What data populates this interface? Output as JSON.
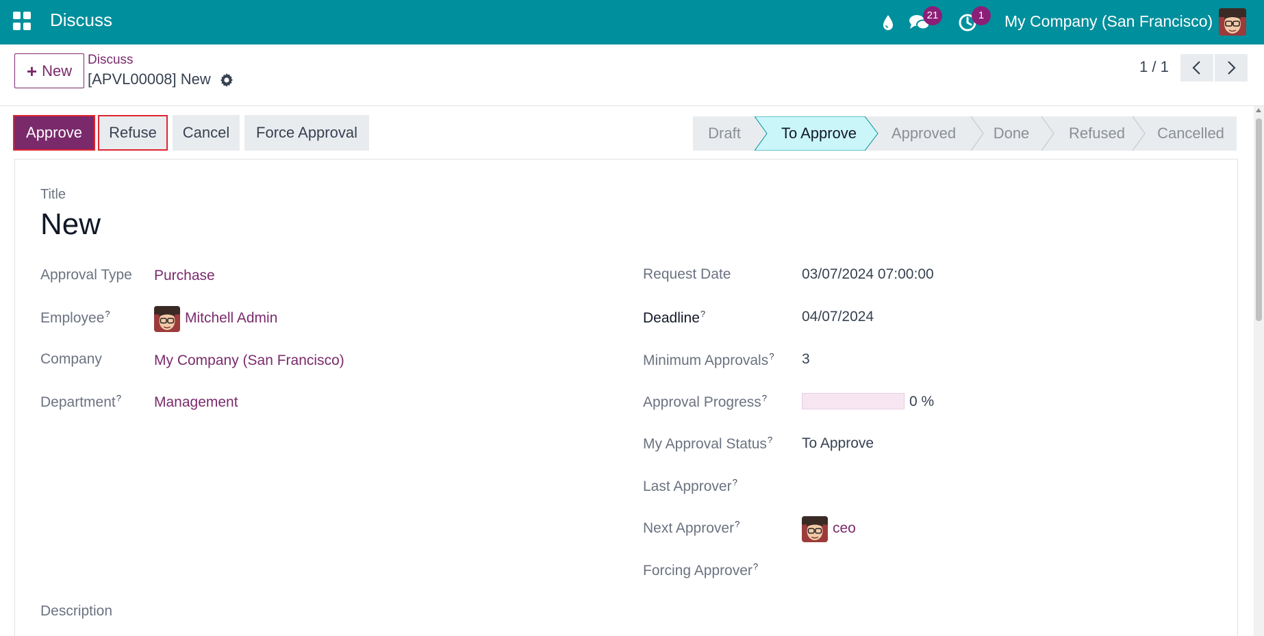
{
  "navbar": {
    "app_title": "Discuss",
    "messages_badge": "21",
    "activity_badge": "1",
    "company": "My Company (San Francisco)",
    "bg_color": "#008f9c",
    "badge_color": "#8b1f77"
  },
  "control_panel": {
    "new_label": "New",
    "breadcrumb": "Discuss",
    "record_name": "[APVL00008] New",
    "pager": "1 / 1"
  },
  "actions": {
    "approve": "Approve",
    "refuse": "Refuse",
    "cancel": "Cancel",
    "force_approval": "Force Approval"
  },
  "stages": [
    "Draft",
    "To Approve",
    "Approved",
    "Done",
    "Refused",
    "Cancelled"
  ],
  "active_stage": "To Approve",
  "form": {
    "title_label": "Title",
    "title_value": "New",
    "left": {
      "approval_type_label": "Approval Type",
      "approval_type_value": "Purchase",
      "employee_label": "Employee",
      "employee_value": "Mitchell Admin",
      "company_label": "Company",
      "company_value": "My Company (San Francisco)",
      "department_label": "Department",
      "department_value": "Management"
    },
    "right": {
      "request_date_label": "Request Date",
      "request_date_value": "03/07/2024 07:00:00",
      "deadline_label": "Deadline",
      "deadline_value": "04/07/2024",
      "min_approvals_label": "Minimum Approvals",
      "min_approvals_value": "3",
      "approval_progress_label": "Approval Progress",
      "approval_progress_value": "0 %",
      "my_status_label": "My Approval Status",
      "my_status_value": "To Approve",
      "last_approver_label": "Last Approver",
      "next_approver_label": "Next Approver",
      "next_approver_value": "ceo",
      "forcing_approver_label": "Forcing Approver"
    },
    "description_label": "Description",
    "help_mark": "?"
  },
  "colors": {
    "primary": "#7a2a6b",
    "active_stage_bg": "#cbf6f9",
    "highlight_border": "#e0242f"
  }
}
